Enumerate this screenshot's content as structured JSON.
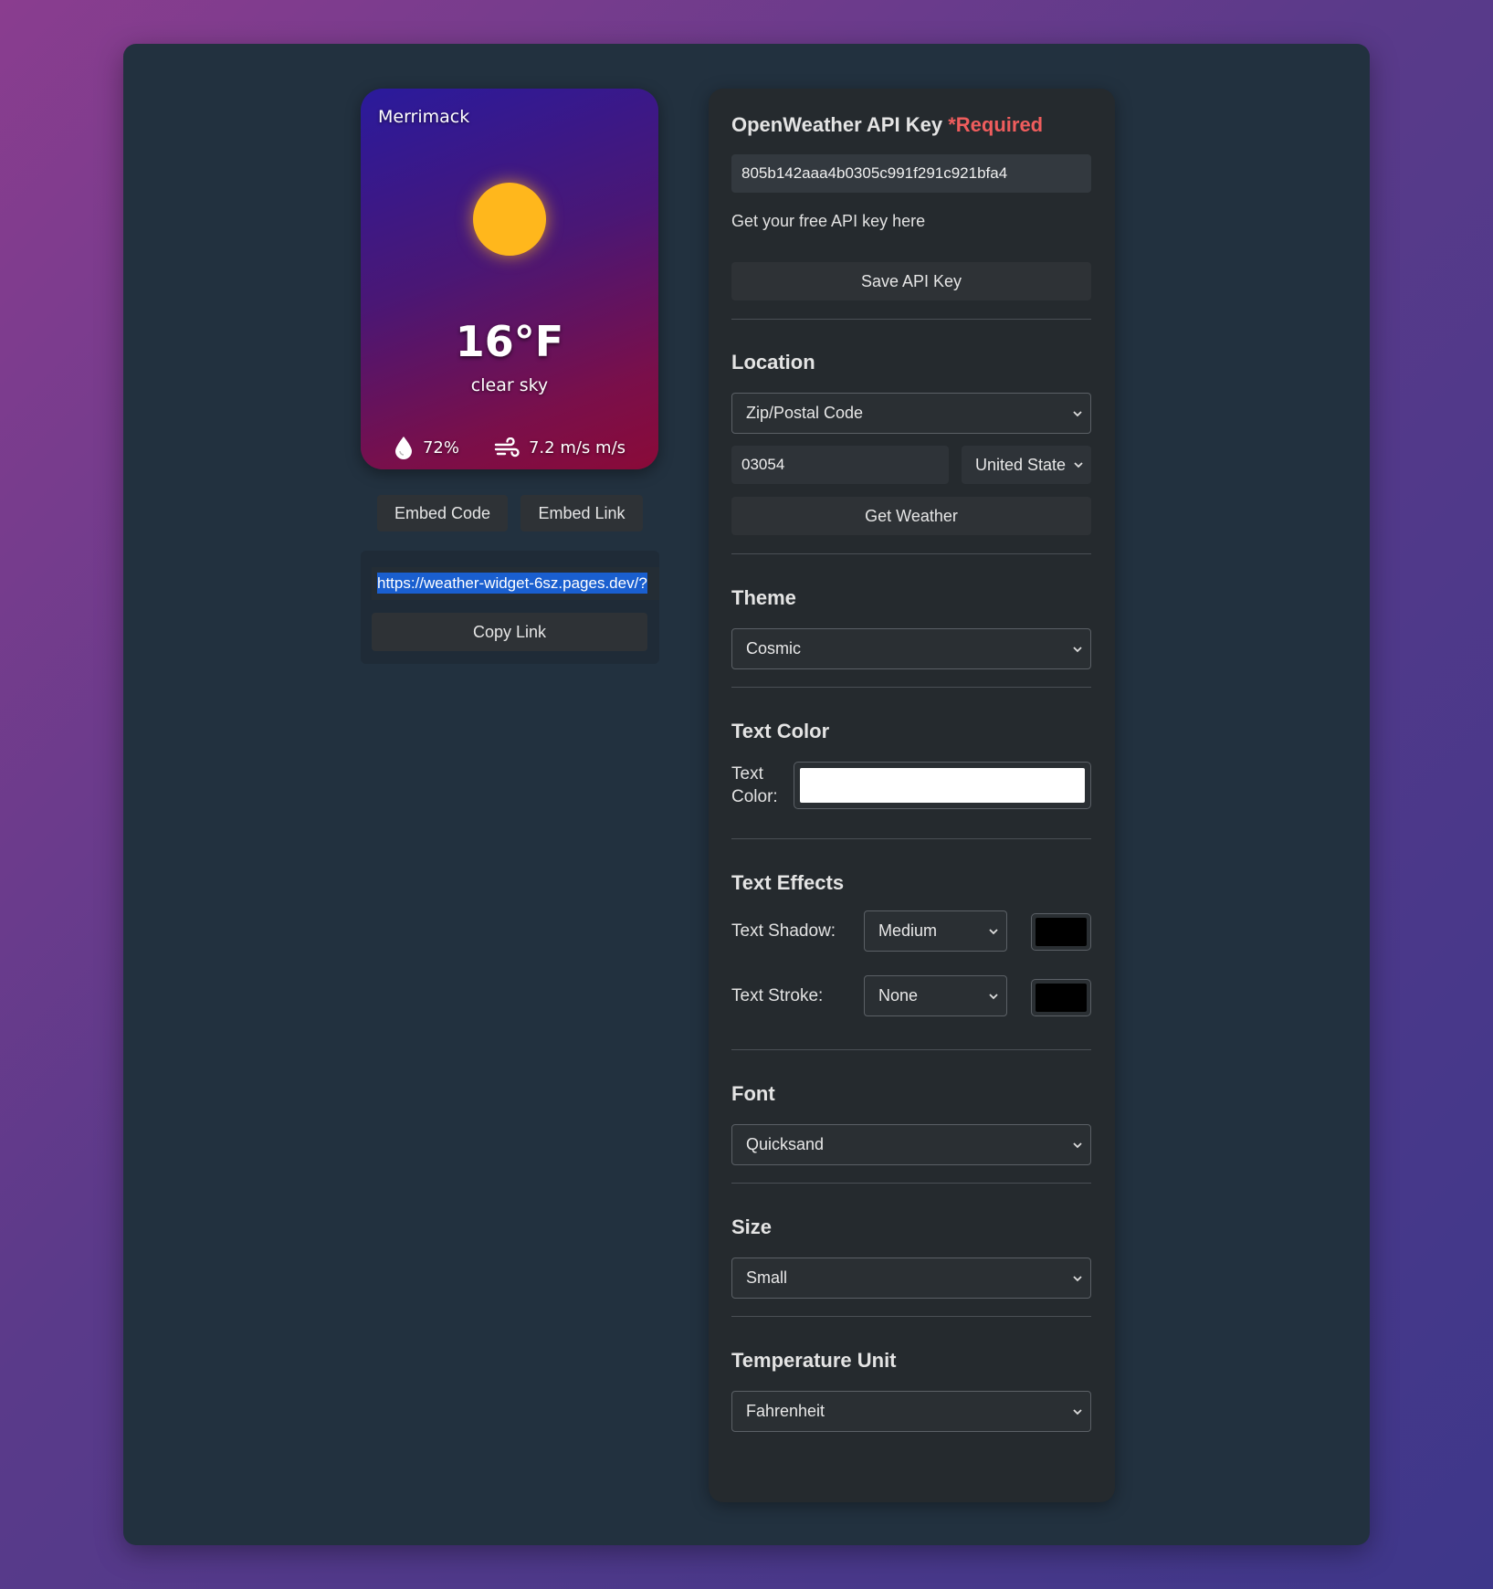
{
  "widget": {
    "city": "Merrimack",
    "temperature": "16°F",
    "condition": "clear sky",
    "humidity": "72%",
    "wind": "7.2 m/s m/s",
    "icons": {
      "condition": "sun-icon",
      "humidity": "droplet-icon",
      "wind": "wind-icon"
    }
  },
  "embed": {
    "code_label": "Embed Code",
    "link_label": "Embed Link",
    "url": "https://weather-widget-6sz.pages.dev/?",
    "copy_label": "Copy Link"
  },
  "settings": {
    "api": {
      "title": "OpenWeather API Key",
      "required": "*Required",
      "key_value": "805b142aaa4b0305c991f291c921bfa4",
      "help_text": "Get your free API key here",
      "save_label": "Save API Key"
    },
    "location": {
      "title": "Location",
      "mode": "Zip/Postal Code",
      "zip": "03054",
      "country": "United State",
      "button": "Get Weather"
    },
    "theme": {
      "title": "Theme",
      "value": "Cosmic"
    },
    "text_color": {
      "title": "Text Color",
      "label_line1": "Text",
      "label_line2": "Color:",
      "value": "#ffffff"
    },
    "text_effects": {
      "title": "Text Effects",
      "shadow_label": "Text Shadow:",
      "shadow_value": "Medium",
      "shadow_color": "#000000",
      "stroke_label": "Text Stroke:",
      "stroke_value": "None",
      "stroke_color": "#000000"
    },
    "font": {
      "title": "Font",
      "value": "Quicksand"
    },
    "size": {
      "title": "Size",
      "value": "Small"
    },
    "unit": {
      "title": "Temperature Unit",
      "value": "Fahrenheit"
    }
  },
  "colors": {
    "accent_required": "#ef5d5d",
    "sun": "#ffb71c",
    "selection": "#1a5fcf"
  }
}
